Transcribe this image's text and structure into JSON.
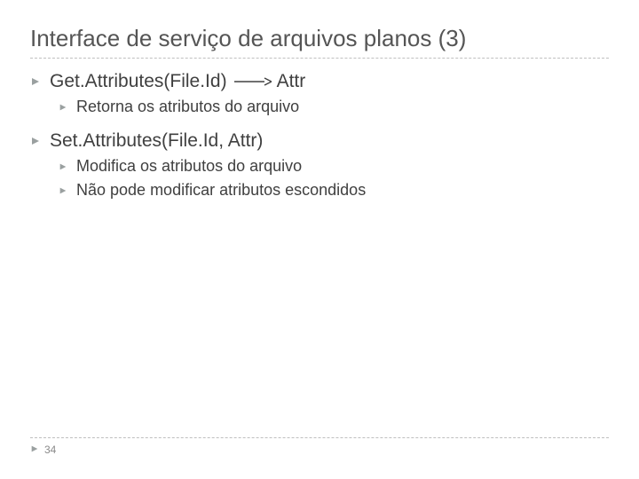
{
  "title": "Interface de serviço de arquivos planos (3)",
  "item1": {
    "text_a": "Get.Attributes(File.Id)",
    "text_b": "Attr",
    "sub1": "Retorna os atributos do arquivo"
  },
  "item2": {
    "text": "Set.Attributes(File.Id, Attr)",
    "sub1": "Modifica os atributos do arquivo",
    "sub2": "Não pode modificar atributos escondidos"
  },
  "page_number": "34"
}
